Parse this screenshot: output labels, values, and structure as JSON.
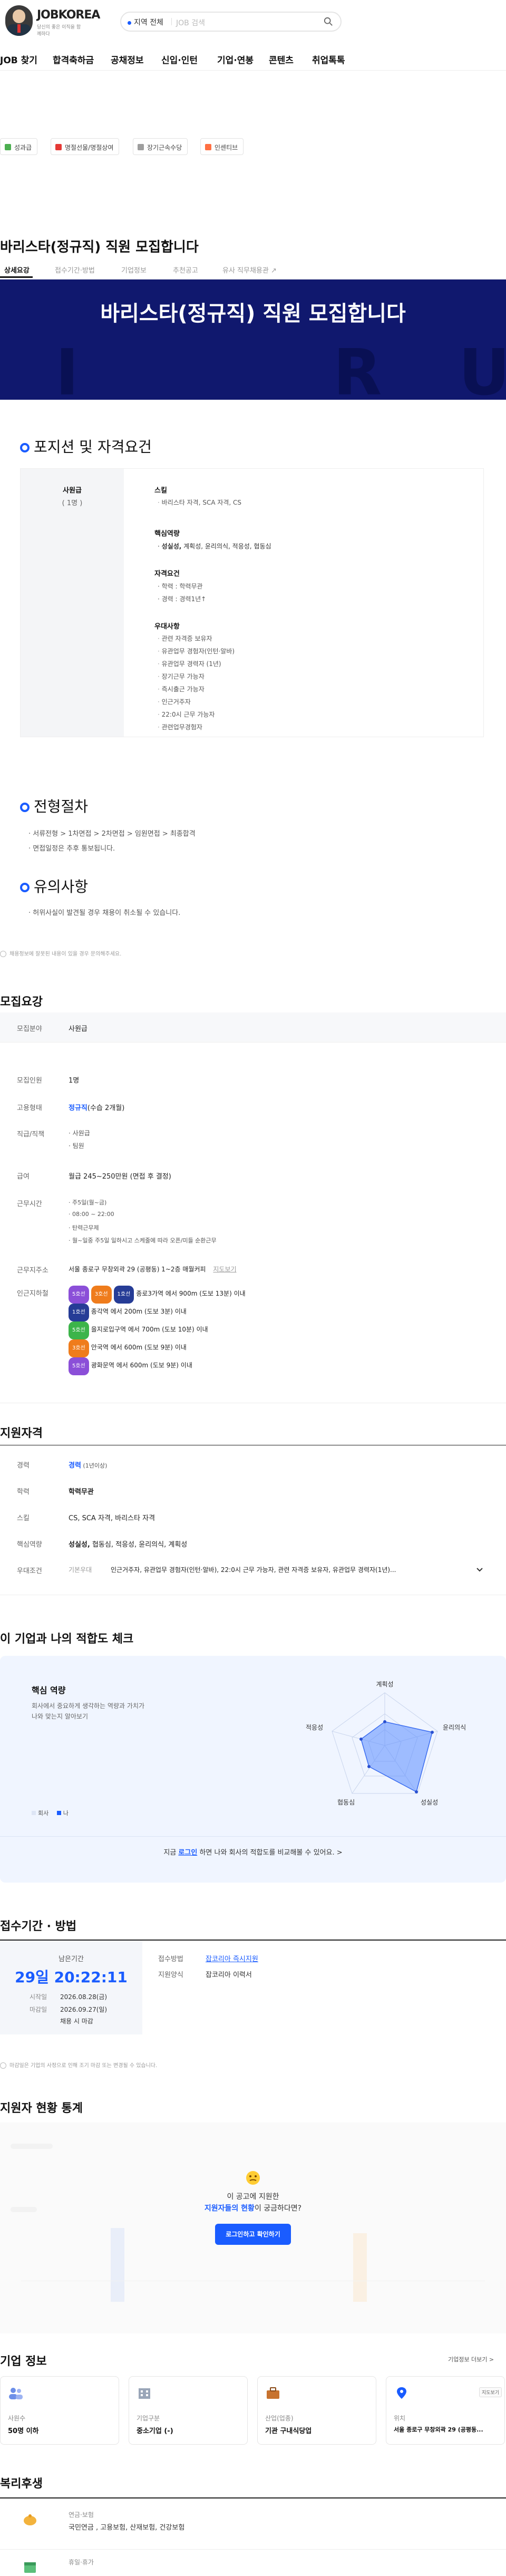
{
  "header": {
    "logo": "JOBKOREA",
    "logo_sub": "당신의 좋은 이직을 함께하다",
    "search": {
      "location": "지역 전체",
      "placeholder": "JOB 검색"
    }
  },
  "nav": [
    "JOB 찾기",
    "합격축하금",
    "공채정보",
    "신입·인턴",
    "기업·연봉",
    "콘텐츠",
    "취업톡톡"
  ],
  "tags": [
    "성과급",
    "명절선물/명절상여",
    "장기근속수당",
    "인센티브"
  ],
  "title": "바리스타(정규직) 직원 모집합니다",
  "tabs": [
    "상세요강",
    "접수기간·방법",
    "기업정보",
    "추천공고",
    "유사 직무채용관 ↗"
  ],
  "banner": {
    "title": "바리스타(정규직) 직원 모집합니다",
    "ghost": [
      "I",
      "R",
      "U"
    ]
  },
  "position": {
    "heading": "포지션 및 자격요건",
    "job": "사원급",
    "count": "( 1명 )",
    "skills_title": "스킬",
    "skills": [
      "바리스타 자격, SCA 자격, CS"
    ],
    "core_title": "핵심역량",
    "core_bold": "성실성,",
    "core_rest": " 계획성, 윤리의식, 적응성, 협동심",
    "qual_title": "자격요건",
    "quals": [
      "· 학력 : 학력무관",
      "· 경력 : 경력1년↑"
    ],
    "pref_title": "우대사항",
    "prefs": [
      "관련 자격증 보유자",
      "유관업무 경험자(인턴·알바)",
      "유관업무 경력자 (1년)",
      "장기근무 가능자",
      "즉시출근 가능자",
      "인근거주자",
      "22:0시 근무 가능자",
      "관련업무경험자"
    ]
  },
  "process": {
    "heading": "전형절차",
    "steps": "서류전형 > 1차면접 > 2차면접 > 임원면접 > 최종합격",
    "note": "면접일정은 추후 통보됩니다."
  },
  "caution": {
    "heading": "유의사항",
    "note": "허위사실이 발견될 경우 채용이 취소될 수 있습니다."
  },
  "footnote1": "채용정보에 잘못된 내용이 있을 경우 문의해주세요.",
  "summary": {
    "heading": "모집요강",
    "field_label": "모집분야",
    "field": "사원급",
    "count_label": "모집인원",
    "count": "1명",
    "type_label": "고용형태",
    "type": "정규직",
    "type_note": "(수습 2개월)",
    "rank_label": "직급/직책",
    "ranks": [
      "사원급",
      "팀원"
    ],
    "pay_label": "급여",
    "pay": "월급 245~250만원 (면접 후 결정)",
    "hours_label": "근무시간",
    "hours": [
      "주5일(월~금)",
      "08:00 ~ 22:00",
      "탄력근무제",
      "월~일중 주5일 일하시고 스케줄에 따라 오픈/미들 순환근무"
    ],
    "addr_label": "근무지주소",
    "addr": "서울 종로구 무창외곽 29 (공평동) 1~2층 매월커피",
    "map_link": "지도보기",
    "station_label": "인근지하철",
    "stations": [
      {
        "lines": [
          "5호선",
          "3호선",
          "1호선"
        ],
        "text": "종로3가역 에서 900m (도보 13분) 이내",
        "colors": [
          "#8b4fd8",
          "#ef7c1c",
          "#263c96"
        ]
      },
      {
        "lines": [
          "1호선"
        ],
        "text": "종각역 에서 200m (도보 3분) 이내",
        "colors": [
          "#263c96"
        ]
      },
      {
        "lines": [
          "5호선"
        ],
        "text": "을지로입구역 에서 700m (도보 10분) 이내",
        "colors": [
          "#3cb44a"
        ]
      },
      {
        "lines": [
          "3호선"
        ],
        "text": "안국역 에서 600m (도보 9분) 이내",
        "colors": [
          "#ef7c1c"
        ]
      },
      {
        "lines": [
          "5호선"
        ],
        "text": "광화문역 에서 600m (도보 9분) 이내",
        "colors": [
          "#8b4fd8"
        ]
      }
    ]
  },
  "qualification": {
    "heading": "지원자격",
    "career_label": "경력",
    "career": "경력",
    "career_note": " (1년이상)",
    "edu_label": "학력",
    "edu": "학력무관",
    "skill_label": "스킬",
    "skill": "CS, SCA 자격, 바리스타 자격",
    "core_label": "핵심역량",
    "core_bold": "성실성,",
    "core_rest": " 협동심, 적응성, 윤리의식, 계획성",
    "pref_label": "우대조건",
    "pref_tag": "기본우대",
    "pref": "인근거주자, 유관업무 경험자(인턴·알바), 22:0시 근무 가능자, 관련 자격증 보유자, 유관업무 경력자(1년)..."
  },
  "fit": {
    "heading": "이 기업과 나의 적합도 체크",
    "core_title": "핵심 역량",
    "core_desc1": "회사에서 중요하게 생각하는 역량과 가치가",
    "core_desc2": "나와 맞는지 알아보기",
    "axes": [
      "계획성",
      "윤리의식",
      "성실성",
      "협동심",
      "적응성"
    ],
    "legend_company": "회사",
    "legend_me": "나",
    "cta_pre": "지금 ",
    "cta_link": "로그인",
    "cta_post": " 하면 나와 회사의 적합도를 비교해볼 수 있어요. >"
  },
  "apply": {
    "heading": "접수기간 · 방법",
    "remain_label": "남은기간",
    "remain": "29일 20:22:11",
    "start_label": "시작일",
    "start": "2026.08.28(금)",
    "end_label": "마감일",
    "end": "2026.09.27(일)",
    "end_note": "채용 시 마감",
    "method_label": "접수방법",
    "method": "잡코리아 즉시지원",
    "form_label": "지원양식",
    "form": "잡코리아 이력서",
    "note": "마감일은 기업의 사정으로 인해 조기 마감 또는 변경될 수 있습니다."
  },
  "stats": {
    "heading": "지원자 현황 통계",
    "question1": "이 공고에 지원한",
    "question2_bold": "지원자들의 현황",
    "question2_rest": "이 궁금하다면?",
    "button": "로그인하고 확인하기"
  },
  "company": {
    "heading": "기업 정보",
    "more": "기업정보 더보기 >",
    "cards": [
      {
        "key": "사원수",
        "val": "50명 이하"
      },
      {
        "key": "기업구분",
        "val": "중소기업 (-)"
      },
      {
        "key": "산업(업종)",
        "val": "기관 구내식당업"
      },
      {
        "key": "위치",
        "val": "서울 종로구 무창외곽 29 (공평동..."
      }
    ],
    "map_badge": "지도보기"
  },
  "welfare": {
    "heading": "복리후생",
    "items": [
      {
        "title": "연금·보험",
        "desc": "국민연금 , 고용보험, 산재보험, 건강보험"
      },
      {
        "title": "휴일·휴가",
        "desc": ""
      }
    ]
  }
}
